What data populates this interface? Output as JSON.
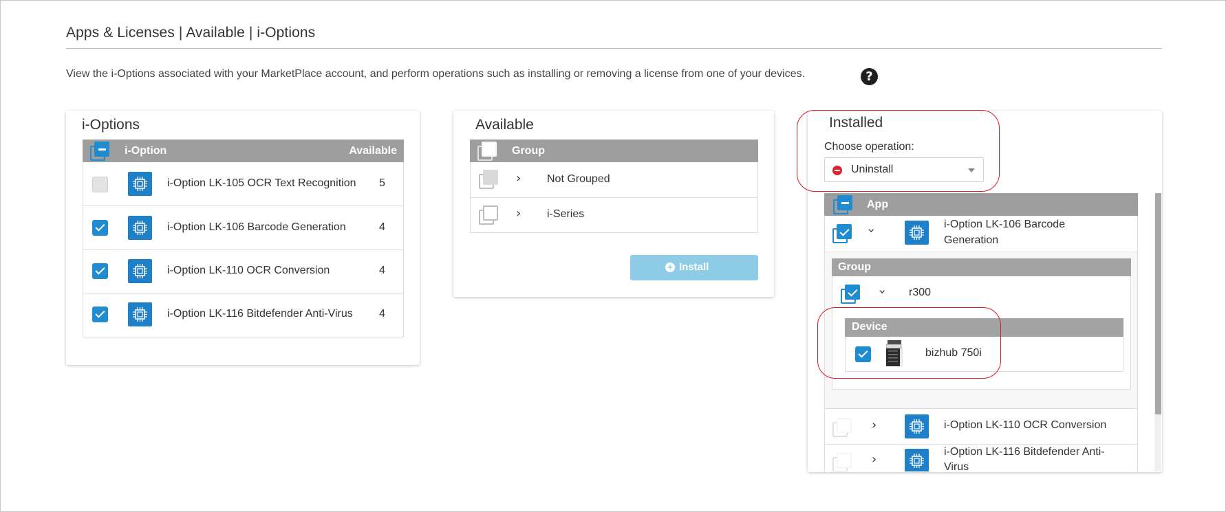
{
  "page": {
    "title": "Apps & Licenses | Available | i-Options",
    "description": "View the i-Options associated with your MarketPlace account, and perform operations such as installing or removing a license from one of your devices.",
    "help_icon": "question-circle-icon"
  },
  "ioptions_panel": {
    "title": "i-Options",
    "col_option": "i-Option",
    "col_available": "Available",
    "rows": [
      {
        "name": "i-Option LK-105 OCR Text Recognition",
        "available": "5",
        "checked": false
      },
      {
        "name": "i-Option LK-106 Barcode Generation",
        "available": "4",
        "checked": true
      },
      {
        "name": "i-Option LK-110 OCR Conversion",
        "available": "4",
        "checked": true
      },
      {
        "name": "i-Option LK-116 Bitdefender Anti-Virus",
        "available": "4",
        "checked": true
      }
    ]
  },
  "available_panel": {
    "title": "Available",
    "col_group": "Group",
    "rows": [
      {
        "name": "Not Grouped"
      },
      {
        "name": "i-Series"
      }
    ],
    "install_label": "Install"
  },
  "installed_panel": {
    "title": "Installed",
    "choose_label": "Choose operation:",
    "operation_value": "Uninstall",
    "col_app": "App",
    "apps": [
      {
        "name_line1": "i-Option LK-106 Barcode",
        "name_line2": "Generation",
        "expanded": true
      },
      {
        "name_line1": "i-Option LK-110 OCR Conversion",
        "name_line2": "",
        "expanded": false
      },
      {
        "name_line1": "i-Option LK-116 Bitdefender Anti-",
        "name_line2": "Virus",
        "expanded": false
      }
    ],
    "group_header": "Group",
    "group_name": "r300",
    "device_header": "Device",
    "device_name": "bizhub 750i"
  },
  "colors": {
    "accent_blue": "#1f8bd1",
    "header_grey": "#9e9e9e",
    "install_button": "#8ecbe6",
    "highlight_red": "#e0191d",
    "uninstall_red": "#e0262a"
  }
}
